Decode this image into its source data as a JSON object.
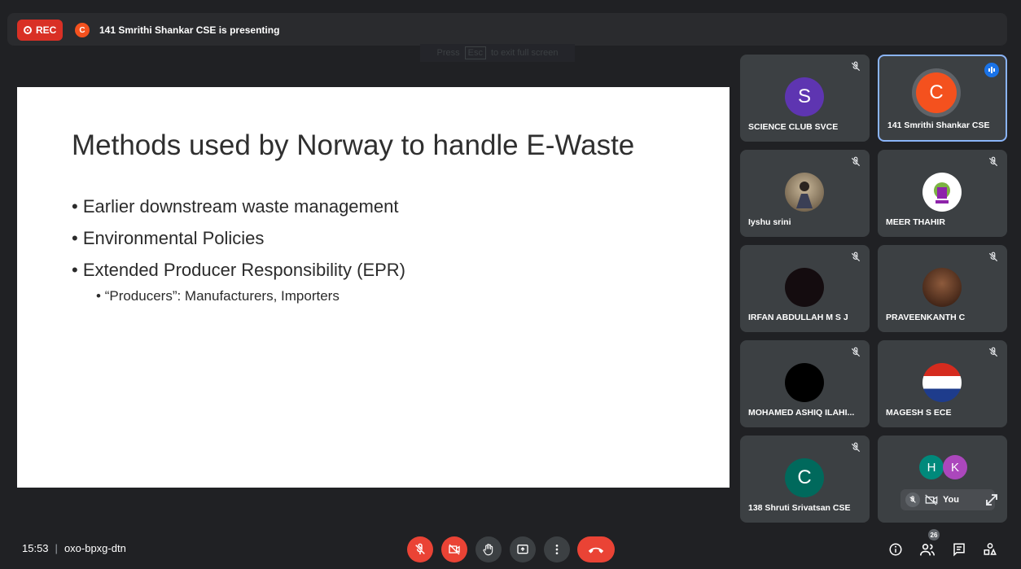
{
  "top": {
    "rec_label": "REC",
    "presenter_initial": "C",
    "presenting_text": "141 Smrithi Shankar CSE is presenting",
    "esc_hint": {
      "press": "Press",
      "key": "Esc",
      "tail": "to exit full screen"
    }
  },
  "slide": {
    "title": "Methods used by Norway to handle E-Waste",
    "bullets": [
      "Earlier downstream waste management",
      "Environmental Policies",
      "Extended Producer Responsibility (EPR)"
    ],
    "sub_bullet": "“Producers”: Manufacturers, Importers"
  },
  "participants": [
    {
      "name": "SCIENCE CLUB SVCE",
      "initial": "S",
      "color": "#5e35b1",
      "muted": true
    },
    {
      "name": "141 Smrithi Shankar CSE",
      "initial": "C",
      "color": "#f4511e",
      "speaking": true
    },
    {
      "name": "Iyshu srini",
      "initial": "",
      "avatar": "photo",
      "muted": true
    },
    {
      "name": "MEER THAHIR",
      "initial": "",
      "avatar": "logo",
      "muted": true
    },
    {
      "name": "IRFAN ABDULLAH M S J",
      "initial": "",
      "avatar": "dark-photo",
      "muted": true
    },
    {
      "name": "PRAVEENKANTH C",
      "initial": "",
      "avatar": "photo",
      "muted": true
    },
    {
      "name": "MOHAMED ASHIQ ILAHI...",
      "initial": "",
      "avatar": "black",
      "muted": true
    },
    {
      "name": "MAGESH S ECE",
      "initial": "",
      "avatar": "flag",
      "muted": true
    },
    {
      "name": "138 Shruti Srivatsan CSE",
      "initial": "C",
      "color": "#00695c",
      "muted": true
    }
  ],
  "self_tile": {
    "stack": [
      {
        "initial": "H",
        "color": "#00897b"
      },
      {
        "initial": "K",
        "color": "#ab47bc"
      }
    ],
    "label": "You"
  },
  "bottom": {
    "time": "15:53",
    "meeting_code": "oxo-bpxg-dtn",
    "participant_count": "26"
  }
}
